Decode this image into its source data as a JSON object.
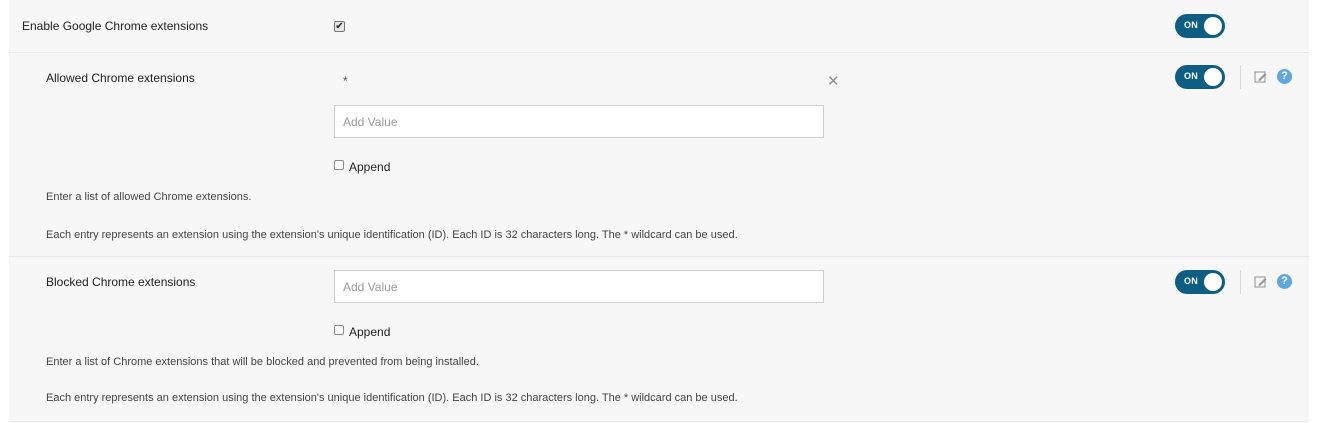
{
  "settings": {
    "enable_extensions": {
      "label": "Enable Google Chrome extensions",
      "checked": true,
      "toggle_label": "ON"
    },
    "allowed": {
      "label": "Allowed Chrome extensions",
      "existing_value": "*",
      "input_placeholder": "Add Value",
      "append_label": "Append",
      "toggle_label": "ON",
      "help_line_1": "Enter a list of allowed Chrome extensions.",
      "help_line_2": "Each entry represents an extension using the extension's unique identification (ID). Each ID is 32 characters long. The * wildcard can be used."
    },
    "blocked": {
      "label": "Blocked Chrome extensions",
      "input_placeholder": "Add Value",
      "append_label": "Append",
      "toggle_label": "ON",
      "help_line_1": "Enter a list of Chrome extensions that will be blocked and prevented from being installed.",
      "help_line_2": "Each entry represents an extension using the extension's unique identification (ID). Each ID is 32 characters long. The * wildcard can be used."
    }
  },
  "icons": {
    "checkmark": "✔",
    "remove": "✕",
    "help": "?"
  },
  "colors": {
    "toggle_on": "#0e5e83",
    "help_icon": "#5ea7e2",
    "row_background": "#f7f7f7"
  }
}
